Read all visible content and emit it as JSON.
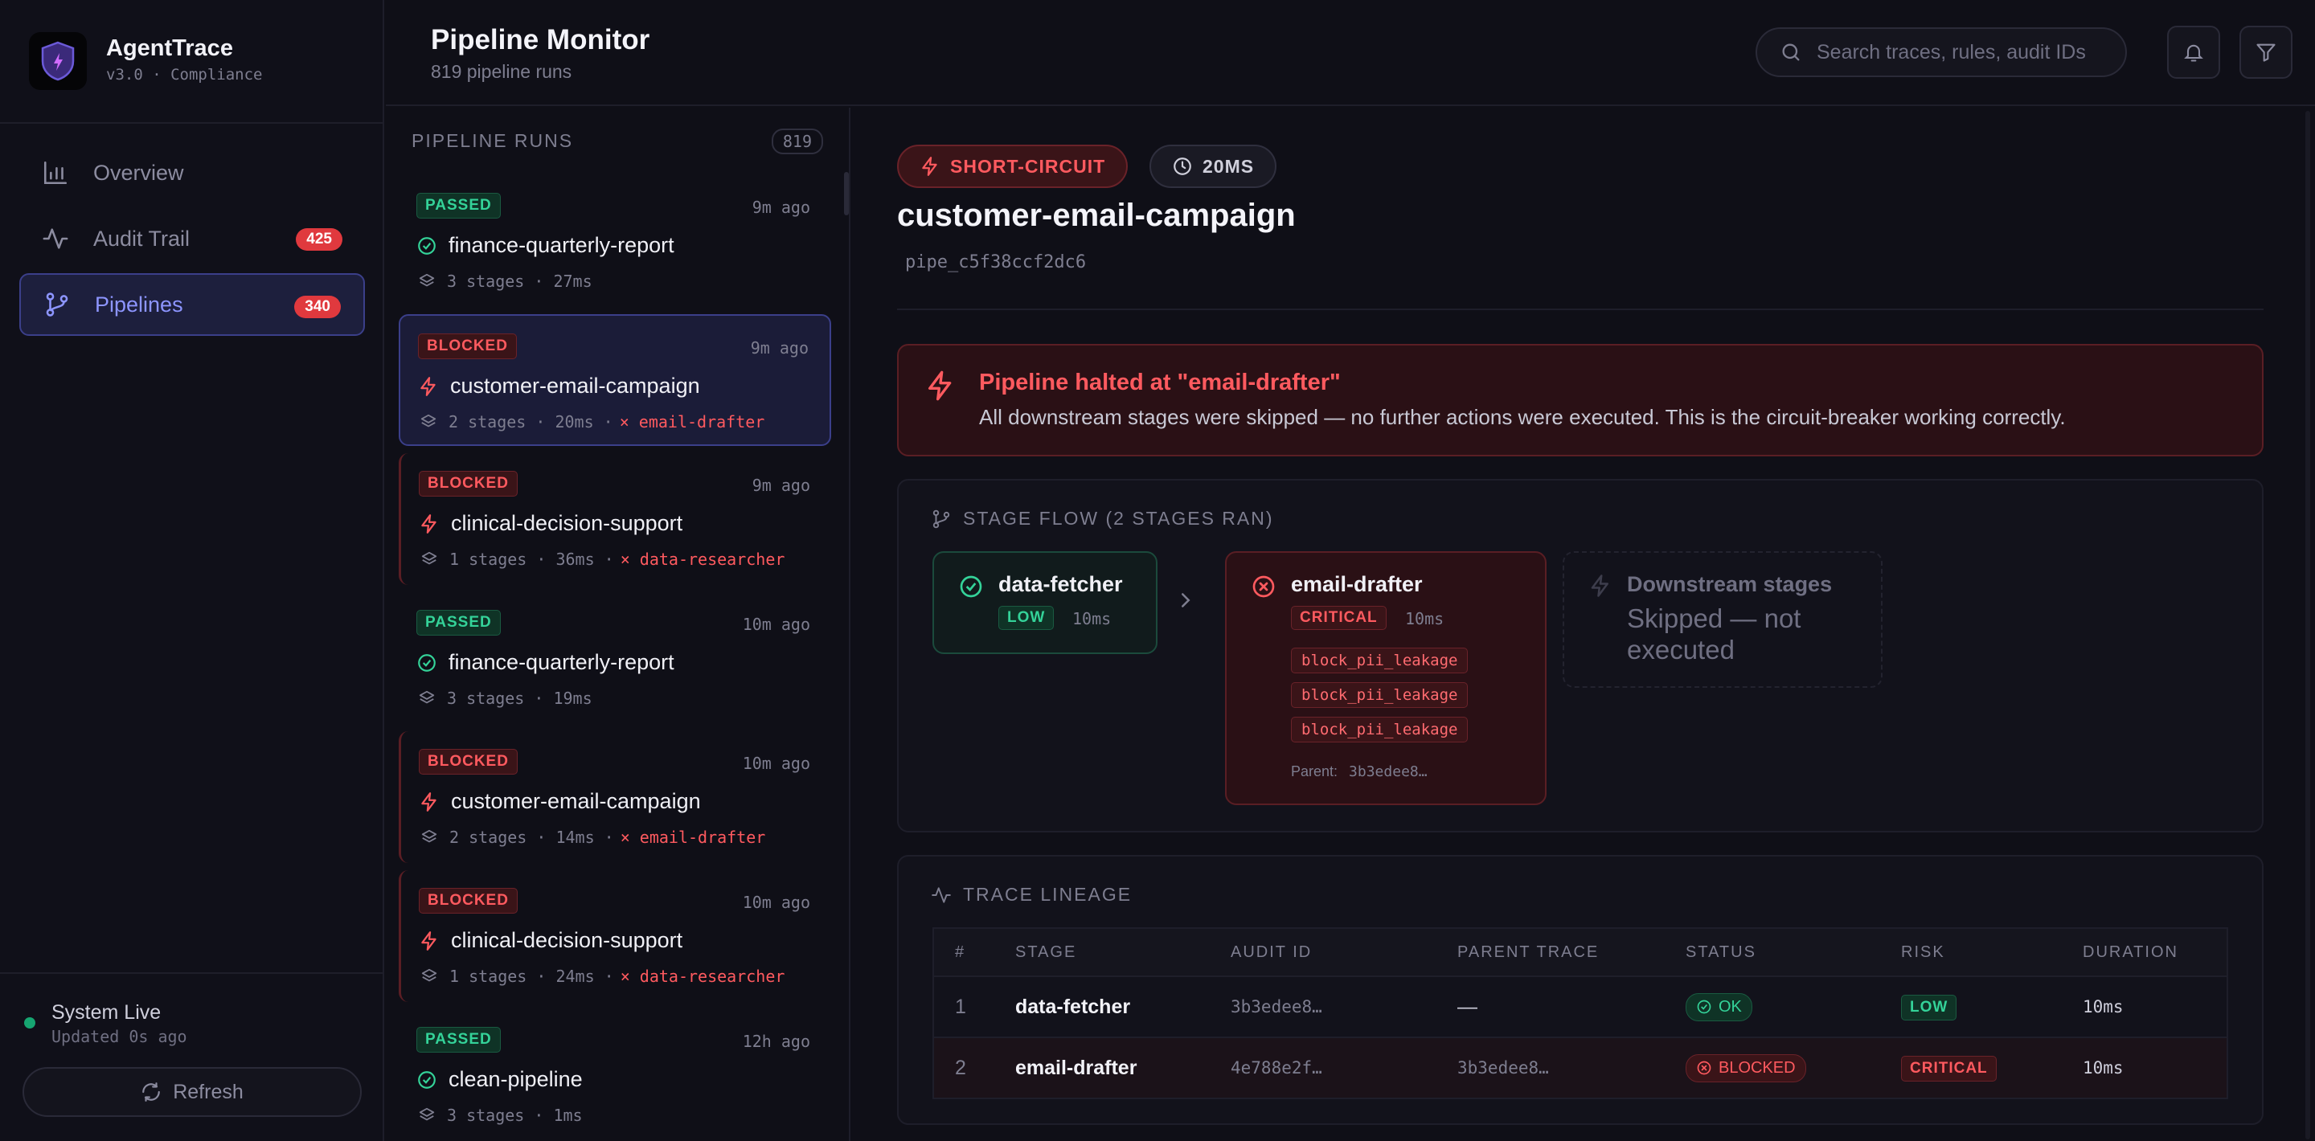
{
  "app": {
    "name": "AgentTrace",
    "version": "v3.0 · Compliance"
  },
  "nav": [
    {
      "label": "Overview",
      "icon": "bar-chart-icon",
      "badge": ""
    },
    {
      "label": "Audit Trail",
      "icon": "activity-icon",
      "badge": "425"
    },
    {
      "label": "Pipelines",
      "icon": "git-branch-icon",
      "badge": "340",
      "active": true
    }
  ],
  "system": {
    "title": "System Live",
    "updated": "Updated 0s ago",
    "refresh_label": "Refresh"
  },
  "header": {
    "title": "Pipeline Monitor",
    "subtitle": "819 pipeline runs",
    "search_placeholder": "Search traces, rules, audit IDs"
  },
  "runs_panel": {
    "heading": "PIPELINE RUNS",
    "count": "819"
  },
  "runs": [
    {
      "status": "PASSED",
      "time": "9m ago",
      "name": "finance-quarterly-report",
      "meta": "3 stages · 27ms",
      "failed_stage": ""
    },
    {
      "status": "BLOCKED",
      "time": "9m ago",
      "name": "customer-email-campaign",
      "meta": "2 stages · 20ms ·",
      "failed_stage": "× email-drafter",
      "selected": true
    },
    {
      "status": "BLOCKED",
      "time": "9m ago",
      "name": "clinical-decision-support",
      "meta": "1 stages · 36ms ·",
      "failed_stage": "× data-researcher"
    },
    {
      "status": "PASSED",
      "time": "10m ago",
      "name": "finance-quarterly-report",
      "meta": "3 stages · 19ms",
      "failed_stage": ""
    },
    {
      "status": "BLOCKED",
      "time": "10m ago",
      "name": "customer-email-campaign",
      "meta": "2 stages · 14ms ·",
      "failed_stage": "× email-drafter"
    },
    {
      "status": "BLOCKED",
      "time": "10m ago",
      "name": "clinical-decision-support",
      "meta": "1 stages · 24ms ·",
      "failed_stage": "× data-researcher"
    },
    {
      "status": "PASSED",
      "time": "12h ago",
      "name": "clean-pipeline",
      "meta": "3 stages · 1ms",
      "failed_stage": ""
    }
  ],
  "detail": {
    "short_circuit_label": "SHORT-CIRCUIT",
    "duration_label": "20MS",
    "title": "customer-email-campaign",
    "pipeline_id": "pipe_c5f38ccf2dc6",
    "alert": {
      "title": "Pipeline halted at \"email-drafter\"",
      "text": "All downstream stages were skipped — no further actions were executed. This is the circuit-breaker working correctly."
    },
    "stage_flow": {
      "heading": "STAGE FLOW (2 STAGES RAN)",
      "stages": [
        {
          "name": "data-fetcher",
          "risk": "LOW",
          "ms": "10ms"
        },
        {
          "name": "email-drafter",
          "risk": "CRITICAL",
          "ms": "10ms",
          "rules": [
            "block_pii_leakage",
            "block_pii_leakage",
            "block_pii_leakage"
          ],
          "parent_label": "Parent:",
          "parent": "3b3edee8…"
        }
      ],
      "downstream": {
        "name": "Downstream stages",
        "text": "Skipped — not executed"
      }
    },
    "lineage": {
      "heading": "TRACE LINEAGE",
      "columns": [
        "#",
        "STAGE",
        "AUDIT ID",
        "PARENT TRACE",
        "STATUS",
        "RISK",
        "DURATION"
      ],
      "rows": [
        {
          "n": "1",
          "stage": "data-fetcher",
          "audit": "3b3edee8…",
          "parent": "—",
          "status": "OK",
          "risk": "LOW",
          "duration": "10ms"
        },
        {
          "n": "2",
          "stage": "email-drafter",
          "audit": "4e788e2f…",
          "parent": "3b3edee8…",
          "status": "BLOCKED",
          "risk": "CRITICAL",
          "duration": "10ms"
        }
      ]
    }
  },
  "colors": {
    "accent": "#8d95ff",
    "passed": "#34d399",
    "blocked": "#ff5a5f",
    "background": "#0f0f17"
  }
}
